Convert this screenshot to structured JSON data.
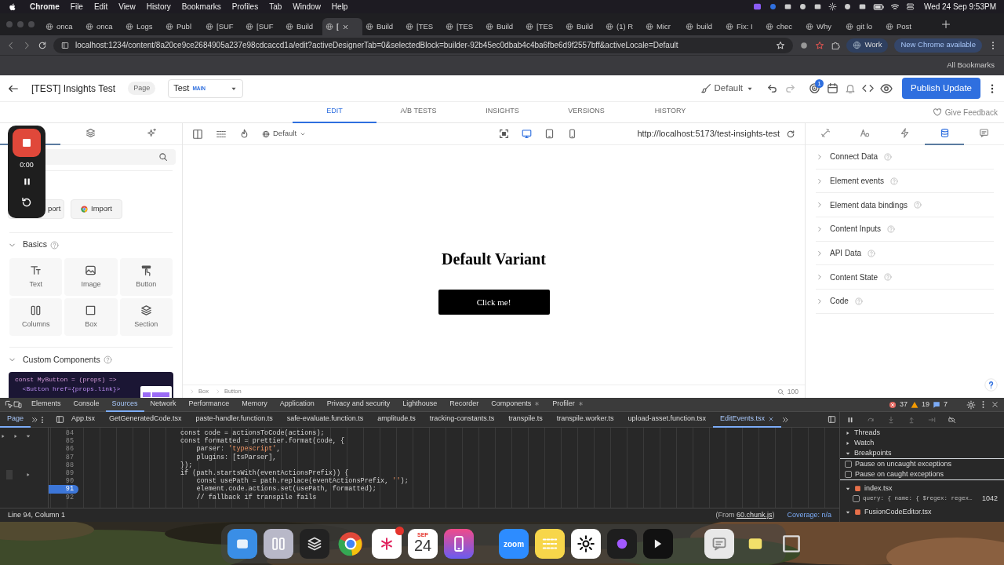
{
  "menu_bar": {
    "app": "Chrome",
    "items": [
      "File",
      "Edit",
      "View",
      "History",
      "Bookmarks",
      "Profiles",
      "Tab",
      "Window",
      "Help"
    ],
    "clock": "Wed 24 Sep 9:53PM"
  },
  "browser_tabs": [
    {
      "label": "onca",
      "selected": false
    },
    {
      "label": "onca",
      "selected": false
    },
    {
      "label": "Logs",
      "selected": false
    },
    {
      "label": "Publ",
      "selected": false
    },
    {
      "label": "[SUF",
      "selected": false
    },
    {
      "label": "[SUF",
      "selected": false
    },
    {
      "label": "Build",
      "selected": false
    },
    {
      "label": "[",
      "selected": true
    },
    {
      "label": "Build",
      "selected": false
    },
    {
      "label": "[TES",
      "selected": false
    },
    {
      "label": "[TES",
      "selected": false
    },
    {
      "label": "Build",
      "selected": false
    },
    {
      "label": "[TES",
      "selected": false
    },
    {
      "label": "Build",
      "selected": false
    },
    {
      "label": "(1) R",
      "selected": false
    },
    {
      "label": "Micr",
      "selected": false
    },
    {
      "label": "build",
      "selected": false
    },
    {
      "label": "Fix: I",
      "selected": false
    },
    {
      "label": "chec",
      "selected": false
    },
    {
      "label": "Why",
      "selected": false
    },
    {
      "label": "git lo",
      "selected": false
    },
    {
      "label": "Post",
      "selected": false
    }
  ],
  "address_bar": {
    "url": "localhost:1234/content/8a20ce9ce2684905a237e98cdcaccd1a/edit?activeDesignerTab=0&selectedBlock=builder-92b45ec0dbab4c4ba6fbe6d9f2557bff&activeLocale=Default",
    "profile": "Work",
    "update": "New Chrome available"
  },
  "bookmarks_bar": {
    "all_bookmarks": "All Bookmarks"
  },
  "header": {
    "title": "[TEST] Insights Test",
    "type_badge": "Page",
    "variant": {
      "label": "Test",
      "tag": "MAIN"
    },
    "locale": "Default",
    "notification_count": "1",
    "publish": "Publish Update"
  },
  "editor_tabs": [
    {
      "label": "EDIT",
      "selected": true
    },
    {
      "label": "A/B TESTS",
      "selected": false
    },
    {
      "label": "INSIGHTS",
      "selected": false
    },
    {
      "label": "VERSIONS",
      "selected": false
    },
    {
      "label": "HISTORY",
      "selected": false
    }
  ],
  "feedback": "Give Feedback",
  "recorder": {
    "time": "0:00"
  },
  "left_panel": {
    "tabs": [
      {
        "selected": true
      },
      {
        "selected": false
      },
      {
        "selected": false
      }
    ],
    "buttons": [
      "port",
      "Import"
    ],
    "basics": {
      "title": "Basics",
      "blocks": [
        "Text",
        "Image",
        "Button",
        "Columns",
        "Box",
        "Section"
      ]
    },
    "custom_components": {
      "title": "Custom Components",
      "code": [
        "const MyButton = (props) =>",
        "  <Button href={props.link}>"
      ]
    }
  },
  "canvas": {
    "locale": "Default",
    "devices": [
      {
        "selected": true
      },
      {
        "selected": false
      },
      {
        "selected": false
      }
    ],
    "url": "http://localhost:5173/test-insights-test",
    "heading": "Default Variant",
    "button": "Click me!",
    "breadcrumbs": [
      "Box",
      "Button"
    ],
    "zoom": "100"
  },
  "right_panel": {
    "tabs": [
      {
        "selected": false
      },
      {
        "selected": false
      },
      {
        "selected": false
      },
      {
        "selected": true
      },
      {
        "selected": false
      }
    ],
    "sections": [
      "Connect Data",
      "Element events",
      "Element data bindings",
      "Content Inputs",
      "API Data",
      "Content State",
      "Code"
    ]
  },
  "devtools": {
    "panels": [
      {
        "label": "Elements",
        "selected": false
      },
      {
        "label": "Console",
        "selected": false
      },
      {
        "label": "Sources",
        "selected": true
      },
      {
        "label": "Network",
        "selected": false
      },
      {
        "label": "Performance",
        "selected": false
      },
      {
        "label": "Memory",
        "selected": false
      },
      {
        "label": "Application",
        "selected": false
      },
      {
        "label": "Privacy and security",
        "selected": false
      },
      {
        "label": "Lighthouse",
        "selected": false
      },
      {
        "label": "Recorder",
        "selected": false
      },
      {
        "label": "Components",
        "selected": false
      },
      {
        "label": "Profiler",
        "selected": false
      }
    ],
    "counts": {
      "errors": "37",
      "warnings": "19",
      "messages": "7"
    },
    "navigator_tab": {
      "label": "Page",
      "selected": true
    },
    "files": [
      {
        "label": "App.tsx",
        "selected": false
      },
      {
        "label": "GetGeneratedCode.tsx",
        "selected": false
      },
      {
        "label": "paste-handler.function.ts",
        "selected": false
      },
      {
        "label": "safe-evaluate.function.ts",
        "selected": false
      },
      {
        "label": "amplitude.ts",
        "selected": false
      },
      {
        "label": "tracking-constants.ts",
        "selected": false
      },
      {
        "label": "transpile.ts",
        "selected": false
      },
      {
        "label": "transpile.worker.ts",
        "selected": false
      },
      {
        "label": "upload-asset.function.tsx",
        "selected": false
      },
      {
        "label": "EditEvents.tsx",
        "selected": true
      }
    ],
    "code": [
      {
        "number": "84",
        "text": "const code = actionsToCode(actions);",
        "breakpoint": false
      },
      {
        "number": "85",
        "text": "const formatted = prettier.format(code, {",
        "breakpoint": false
      },
      {
        "number": "86",
        "text": "    parser: 'typescript',",
        "breakpoint": false
      },
      {
        "number": "87",
        "text": "    plugins: [tsParser],",
        "breakpoint": false
      },
      {
        "number": "88",
        "text": "});",
        "breakpoint": false
      },
      {
        "number": "89",
        "text": "if (path.startsWith(eventActionsPrefix)) {",
        "breakpoint": false
      },
      {
        "number": "90",
        "text": "    const usePath = path.replace(eventActionsPrefix, '');",
        "breakpoint": false
      },
      {
        "number": "91",
        "text": "    element.code.actions.set(usePath, formatted);",
        "breakpoint": true
      },
      {
        "number": "92",
        "text": "    // fallback if transpile fails",
        "breakpoint": false
      }
    ],
    "status": {
      "position": "Line 94, Column 1",
      "source_before": "(From ",
      "source_link": "60.chunk.js",
      "source_after": ")",
      "coverage": "Coverage: n/a"
    },
    "debugger": {
      "sections": [
        {
          "label": "Threads",
          "expanded": false
        },
        {
          "label": "Watch",
          "expanded": false
        },
        {
          "label": "Breakpoints",
          "expanded": true
        }
      ],
      "options": [
        {
          "label": "Pause on uncaught exceptions",
          "checked": false
        },
        {
          "label": "Pause on caught exceptions",
          "checked": false
        }
      ],
      "files": [
        {
          "name": "index.tsx",
          "expanded": true,
          "breakpoints": [
            {
              "code": "query: { name: { $regex: regex…",
              "line": "1042",
              "checked": false
            }
          ]
        },
        {
          "name": "FusionCodeEditor.tsx",
          "expanded": true
        }
      ]
    }
  },
  "dock": {
    "calendar_month": "SEP",
    "calendar_day": "24",
    "zoom_label": "zoom"
  }
}
